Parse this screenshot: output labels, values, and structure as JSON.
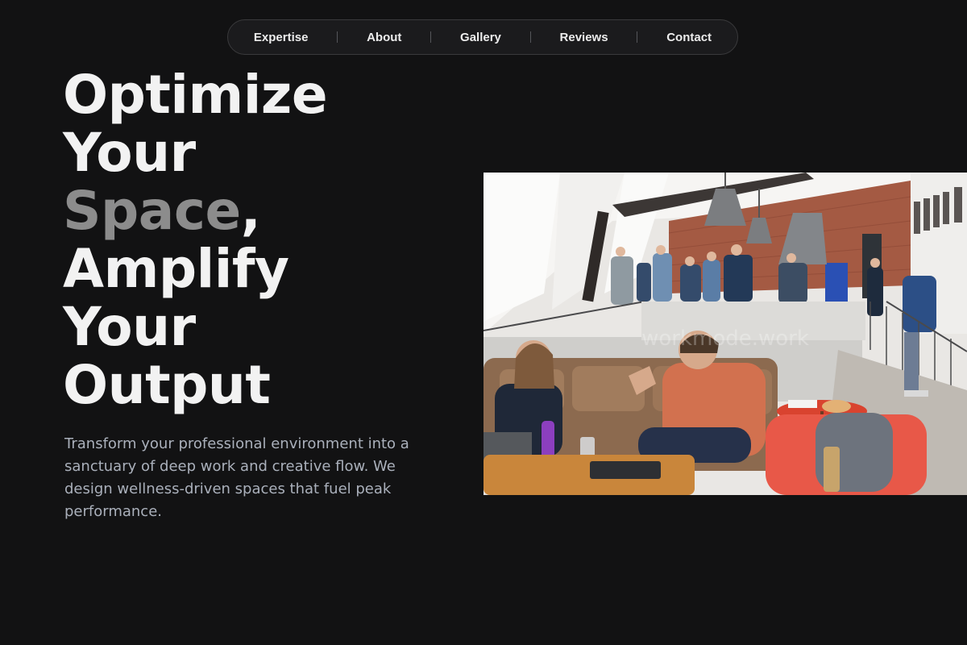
{
  "nav": {
    "items": [
      {
        "label": "Expertise"
      },
      {
        "label": "About"
      },
      {
        "label": "Gallery"
      },
      {
        "label": "Reviews"
      },
      {
        "label": "Contact"
      }
    ]
  },
  "hero": {
    "title": {
      "line1": "Optimize",
      "line2": "Your",
      "line3_muted": "Space",
      "line3_comma": ",",
      "line4": "Amplify",
      "line5": "Your",
      "line6": "Output"
    },
    "subtitle": "Transform your professional environment into a sanctuary of deep work and creative flow. We design wellness-driven spaces that fuel peak performance."
  },
  "photo": {
    "watermark": "workmode.work"
  },
  "colors": {
    "background": "#121213",
    "title": "#f2f2f2",
    "title_muted": "#8c8c8c",
    "subtitle": "#aab0bb",
    "nav_border": "#3a3a3c"
  }
}
